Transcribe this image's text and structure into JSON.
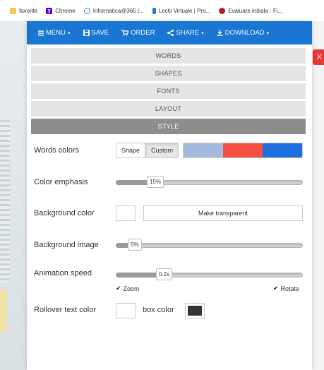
{
  "bookmarks": [
    {
      "label": "favorite",
      "icon": "folder-icon"
    },
    {
      "label": "Chrome",
      "icon": "yahoo-icon"
    },
    {
      "label": "Informatica@365 |...",
      "icon": "wordpress-icon"
    },
    {
      "label": "Lectii Virtuale | Pro...",
      "icon": "lectii-icon"
    },
    {
      "label": "Evaluare initiala - Fi...",
      "icon": "shield-icon"
    }
  ],
  "toolbar": {
    "menu": "MENU",
    "save": "SAVE",
    "order": "ORDER",
    "share": "SHARE",
    "download": "DOWNLOAD",
    "bg_color": "#1976d2"
  },
  "sections": [
    "WORDS",
    "SHAPES",
    "FONTS",
    "LAYOUT",
    "STYLE"
  ],
  "active_section": "STYLE",
  "style": {
    "words_colors": {
      "label": "Words colors",
      "shape_btn": "Shape",
      "custom_btn": "Custom",
      "swatches": [
        "#a3b9dd",
        "#f44f3f",
        "#1e6fe0"
      ]
    },
    "color_emphasis": {
      "label": "Color emphasis",
      "value": "15%",
      "level": 0.15
    },
    "background_color": {
      "label": "Background color",
      "transparent_btn": "Make transparent",
      "value": "#ffffff"
    },
    "background_image": {
      "label": "Background image",
      "value": "5%",
      "level": 0.05
    },
    "animation_speed": {
      "label": "Animation speed",
      "value": "0.2s",
      "level": 0.2
    },
    "zoom": {
      "label": "Zoom",
      "checked": true
    },
    "rotate": {
      "label": "Rotate",
      "checked": true
    },
    "rollover": {
      "label": "Rollover text color",
      "text_color": "#ffffff",
      "box_label": "box color",
      "box_color": "#333333"
    }
  },
  "side_button": {
    "label": "X",
    "color": "#e53935"
  }
}
